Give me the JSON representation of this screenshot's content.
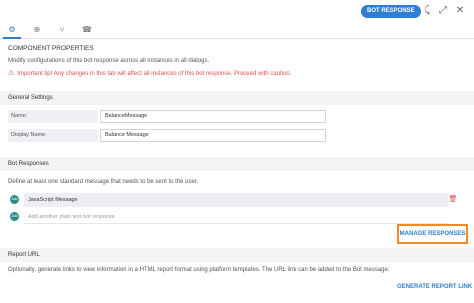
{
  "header": {
    "badge": "BOT RESPONSE",
    "icons": [
      "collapse-icon",
      "expand-icon",
      "close-icon"
    ]
  },
  "tabs": [
    {
      "icon": "gear-icon"
    },
    {
      "icon": "plus-circle-icon"
    },
    {
      "icon": "branch-icon"
    },
    {
      "icon": "phone-icon"
    }
  ],
  "component": {
    "title": "COMPONENT PROPERTIES",
    "description": "Modify configurations of this bot response across all instances in all dialogs.",
    "tip": "Important tip! Any changes in this tab will affect all instances of this bot response. Proceed with caution."
  },
  "general_settings": {
    "heading": "General Settings",
    "name_label": "Name:",
    "name_value": "BalanceMessage",
    "display_name_label": "Display Name:",
    "display_name_value": "Balance Message"
  },
  "bot_responses": {
    "heading": "Bot Responses",
    "description": "Define at least one standard message that needs to be sent to the user.",
    "items": [
      {
        "avatar": "Add",
        "text": "JavaScript Message"
      }
    ],
    "placeholder": "Add another plain text bot response",
    "placeholder_avatar": "Add",
    "manage_label": "MANAGE RESPONSES"
  },
  "report_url": {
    "heading": "Report URL",
    "description": "Optionally, generate links to view information in a HTML report format using platform templates. The URL link can be added to the Bot message.",
    "generate_label": "GENERATE REPORT LINK"
  },
  "colors": {
    "accent": "#2e7fd1",
    "warning": "#d9534f",
    "highlight": "#f08a24"
  }
}
